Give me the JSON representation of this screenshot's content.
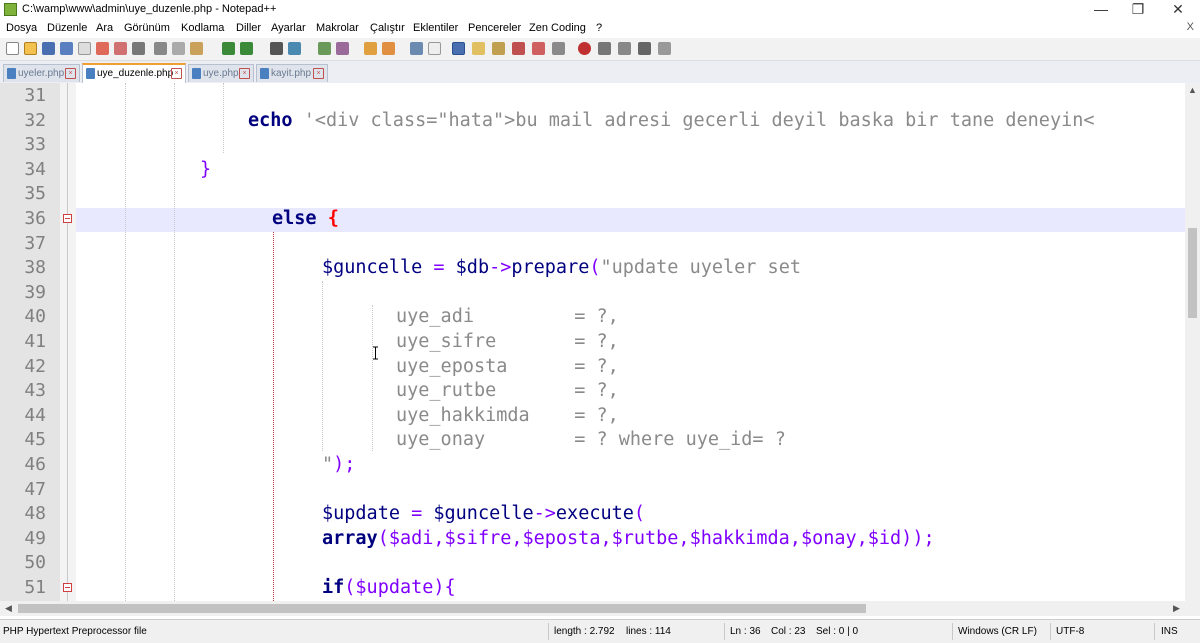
{
  "window": {
    "title": "C:\\wamp\\www\\admin\\uye_duzenle.php - Notepad++",
    "minimize": "—",
    "maximize": "❐",
    "close": "✕"
  },
  "menu": [
    "Dosya",
    "Düzenle",
    "Ara",
    "Görünüm",
    "Kodlama",
    "Diller",
    "Ayarlar",
    "Makrolar",
    "Çalıştır",
    "Eklentiler",
    "Pencereler",
    "Zen Coding",
    "?"
  ],
  "menu_close": "X",
  "tabs": [
    {
      "label": "uyeler.php",
      "active": false
    },
    {
      "label": "uye_duzenle.php",
      "active": true
    },
    {
      "label": "uye.php",
      "active": false
    },
    {
      "label": "kayit.php",
      "active": false
    }
  ],
  "line_numbers": [
    "31",
    "32",
    "33",
    "34",
    "35",
    "36",
    "37",
    "38",
    "39",
    "40",
    "41",
    "42",
    "43",
    "44",
    "45",
    "46",
    "47",
    "48",
    "49",
    "50",
    "51"
  ],
  "code": {
    "l32_echo": "echo",
    "l32_str": "'<div class=\"hata\">bu mail adresi gecerli deyil baska bir tane deneyin<",
    "l34": "}",
    "l36_else": "else",
    "l36_brace": "{",
    "l38_var": "$guncelle",
    "l38_eq": " = ",
    "l38_db": "$db",
    "l38_arrow": "->",
    "l38_fn": "prepare",
    "l38_paren": "(",
    "l38_str": "\"update uyeler set",
    "l40": "uye_adi         = ?,",
    "l41": "uye_sifre       = ?,",
    "l42": "uye_eposta      = ?,",
    "l43": "uye_rutbe       = ?,",
    "l44": "uye_hakkimda    = ?,",
    "l45": "uye_onay        = ? where uye_id= ?",
    "l46_str": "\"",
    "l46_rest": ");",
    "l48_var": "$update",
    "l48_eq": " = ",
    "l48_obj": "$guncelle",
    "l48_arrow": "->",
    "l48_fn": "execute",
    "l48_paren": "(",
    "l49_kw": "array",
    "l49_rest": "($adi,$sifre,$eposta,$rutbe,$hakkimda,$onay,$id));",
    "l51_kw": "if",
    "l51_rest": "($update){"
  },
  "status": {
    "filetype": "PHP Hypertext Preprocessor file",
    "length": "length : 2.792",
    "lines": "lines : 114",
    "ln": "Ln : 36",
    "col": "Col : 23",
    "sel": "Sel : 0 | 0",
    "eol": "Windows (CR LF)",
    "encoding": "UTF-8",
    "mode": "INS"
  },
  "colors": {
    "keyword": "#00007f",
    "string": "#8a8a8a",
    "operator": "#8000ff",
    "current_line": "#e8e8ff",
    "gutter": "#e4e4e4",
    "fold_marker": "#d04040",
    "active_tab_accent": "#f0a030"
  }
}
